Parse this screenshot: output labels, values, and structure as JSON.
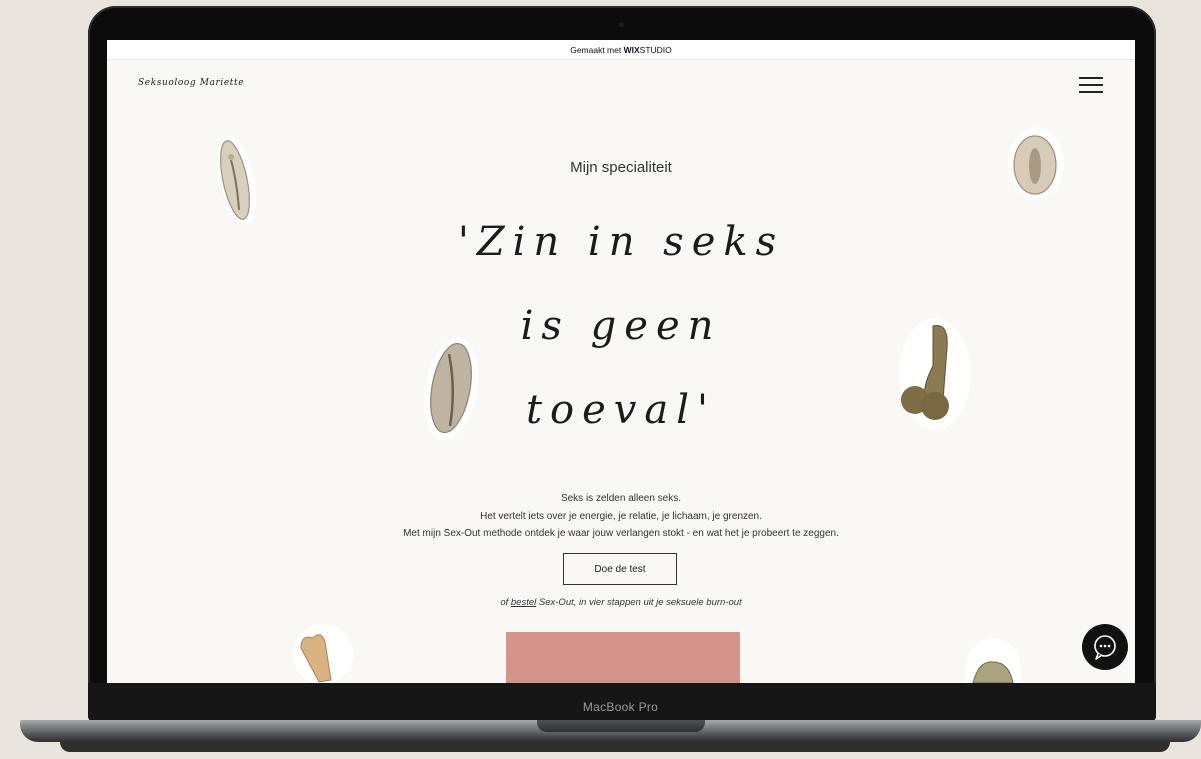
{
  "device": {
    "label": "MacBook Pro"
  },
  "wix_banner": {
    "prefix": "Gemaakt met",
    "brand_bold": "WIX",
    "brand_rest": "STUDIO"
  },
  "site": {
    "logo": "Seksuoloog Mariette",
    "menu_icon": "hamburger-menu-icon"
  },
  "hero": {
    "subtitle": "Mijn specialiteit",
    "headline_lines": [
      "'Zin in seks",
      "is geen",
      "toeval'"
    ]
  },
  "intro": {
    "lines": [
      "Seks is zelden alleen seks.",
      "Het vertelt iets over je energie, je relatie, je lichaam, je grenzen.",
      "Met mijn Sex-Out methode ontdek je waar jouw verlangen stokt - en wat het je probeert te zeggen."
    ],
    "cta_label": "Doe de test",
    "order_prefix": "of",
    "order_link": "bestel",
    "order_suffix": "Sex-Out, in vier stappen uit je seksuele burn-out"
  },
  "chat": {
    "icon": "chat-bubble-icon"
  },
  "colors": {
    "pink_block": "#d4948a",
    "page_bg": "#f9f8f5",
    "backdrop": "#e9e5dc"
  }
}
